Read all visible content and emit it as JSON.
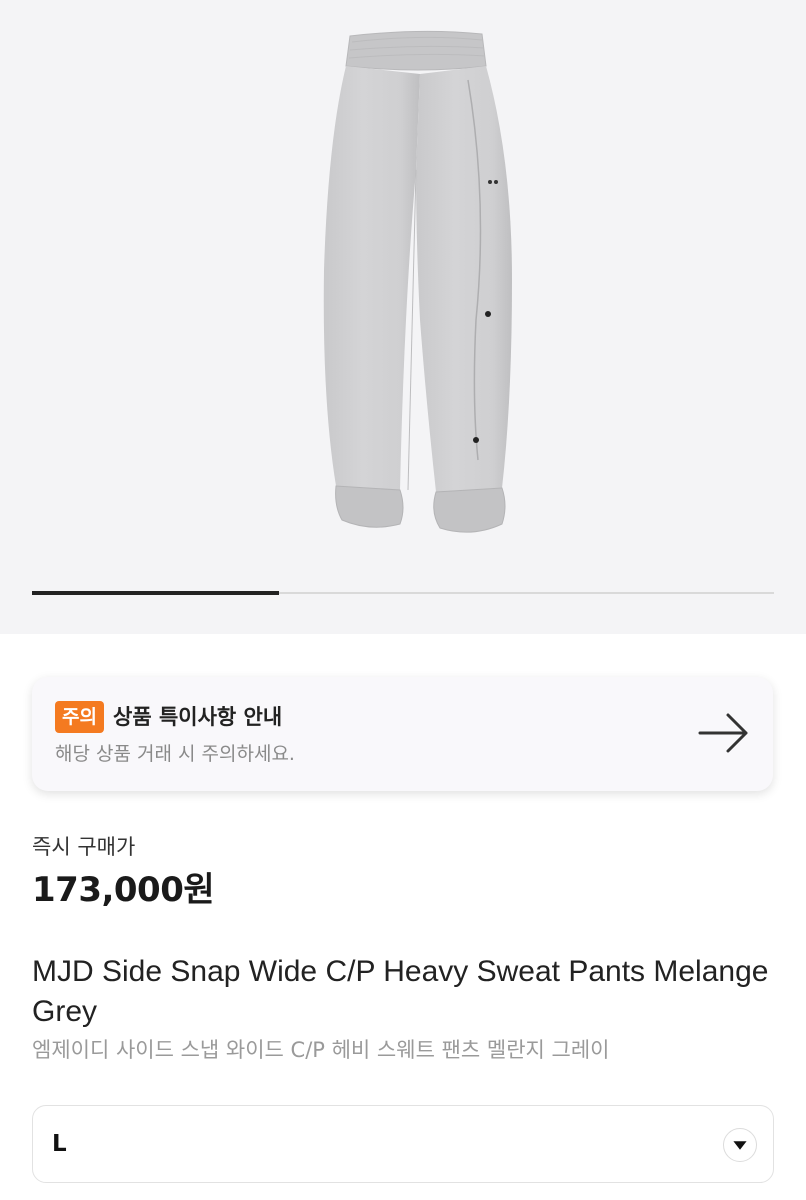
{
  "gallery": {
    "image_alt": "product-photo",
    "progress_fraction": 0.333
  },
  "notice": {
    "badge": "주의",
    "title": "상품 특이사항 안내",
    "subtitle": "해당 상품 거래 시 주의하세요.",
    "icon": "arrow-right-icon",
    "badge_color": "#f47a20"
  },
  "price": {
    "label": "즉시 구매가",
    "value": "173,000원"
  },
  "product": {
    "name": "MJD Side Snap Wide C/P Heavy Sweat Pants Melange Grey",
    "name_ko": "엠제이디 사이드 스냅 와이드 C/P 헤비 스웨트 팬츠 멜란지 그레이"
  },
  "size_select": {
    "value": "L",
    "icon": "chevron-down-icon"
  }
}
